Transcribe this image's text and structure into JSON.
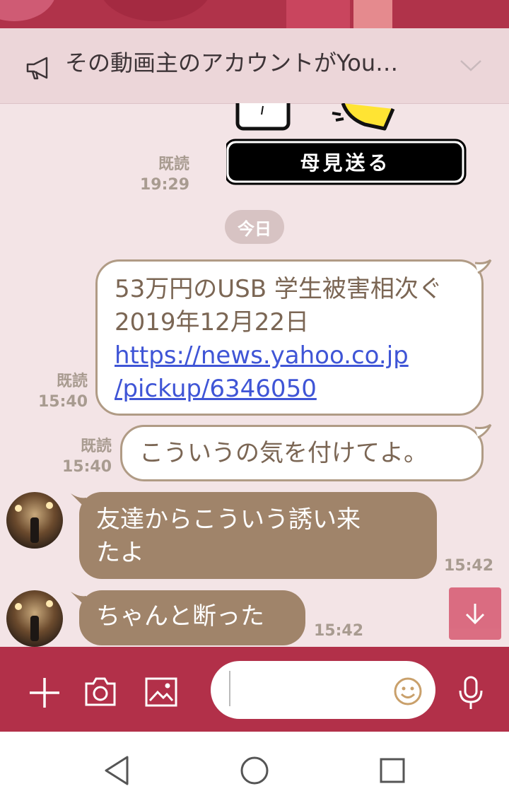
{
  "announcement": {
    "text": "その動画主のアカウントがYou…",
    "icon": "megaphone-icon",
    "toggle_icon": "chevron-down-icon"
  },
  "sticker": {
    "label": "母見送る",
    "read_label": "既読",
    "time": "19:29"
  },
  "date_divider": "今日",
  "messages": [
    {
      "direction": "outgoing",
      "text": "53万円のUSB 学生被害相次ぐ 2019年12月22日",
      "link_line1": "https://news.yahoo.co.jp",
      "link_line2": "/pickup/6346050",
      "read_label": "既読",
      "time": "15:40"
    },
    {
      "direction": "outgoing",
      "text": "こういうの気を付けてよ。",
      "read_label": "既読",
      "time": "15:40"
    },
    {
      "direction": "incoming",
      "text_line1": "友達からこういう誘い来",
      "text_line2": "たよ",
      "time": "15:42"
    },
    {
      "direction": "incoming",
      "text": "ちゃんと断った",
      "time": "15:42"
    }
  ],
  "composer": {
    "value": "",
    "placeholder": "",
    "icons": [
      "plus-icon",
      "camera-icon",
      "image-icon",
      "emoji-icon",
      "microphone-icon"
    ]
  },
  "scroll_button_icon": "arrow-down-icon",
  "navigation": [
    "back-icon",
    "home-icon",
    "recents-icon"
  ],
  "colors": {
    "background": "#f3e4e6",
    "input_bar": "#b23049",
    "incoming_bubble": "#a0846a",
    "outgoing_border": "#b09b85",
    "link": "#3f55d6"
  }
}
